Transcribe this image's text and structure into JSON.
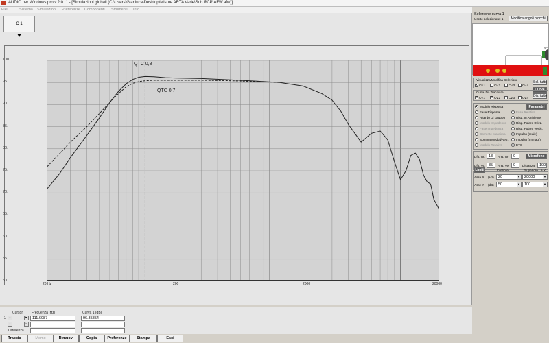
{
  "window": {
    "title": "AUDIO per Windows pro v.2.0 r1 - [Simulazioni globali (C:\\Users\\Gianluca\\Desktop\\Misure ARTA Varie\\Sub RCP\\AFW.afw)]"
  },
  "menu": [
    "File",
    "Sistema",
    "Simulazioni",
    "Preferenze",
    "Componenti",
    "Strumenti",
    "Info"
  ],
  "curve_tab": "C 1",
  "annotations": {
    "qtc08": "QTC 0,8",
    "qtc07": "QTC 0,7"
  },
  "chart_data": {
    "type": "line",
    "x_scale": "log",
    "xlim": [
      20,
      20000
    ],
    "ylim": [
      50,
      100
    ],
    "x_tick_labels": [
      "20 Hz",
      "200",
      "2000",
      "20000"
    ],
    "y_tick_labels": [
      "100.",
      "95.",
      "90.",
      "85.",
      "80.",
      "75.",
      "70.",
      "65.",
      "60.",
      "55.",
      "50."
    ],
    "grid": true,
    "series": [
      {
        "style": "solid",
        "x": [
          20,
          25,
          30,
          40,
          50,
          60,
          70,
          80,
          90,
          100,
          111.6,
          130,
          160,
          200,
          300,
          500,
          800,
          1200,
          1800,
          2500,
          3000,
          3500,
          4000,
          5000,
          6000,
          7000,
          8000,
          9000,
          10000,
          11000,
          12000,
          13000,
          14000,
          15000,
          16000,
          17000,
          18000,
          20000
        ],
        "y": [
          71,
          74.5,
          78,
          83,
          87,
          90.5,
          93,
          94.7,
          95.7,
          96.2,
          96.36,
          96.3,
          96.1,
          96,
          95.9,
          95.6,
          95.3,
          95,
          94.2,
          92.5,
          91,
          88.5,
          85.5,
          81.5,
          83.5,
          84,
          82,
          77,
          73,
          75,
          78.5,
          79,
          77.5,
          74,
          72.5,
          72,
          68.5,
          66
        ]
      },
      {
        "style": "dashed",
        "x": [
          20,
          25,
          30,
          40,
          50,
          60,
          70,
          80,
          90,
          100,
          111.6,
          130,
          160,
          200,
          300,
          500,
          800,
          1200
        ],
        "y": [
          76,
          79,
          81.5,
          85,
          88,
          90.5,
          92.5,
          94,
          94.8,
          95.2,
          95.4,
          95.5,
          95.5,
          95.5,
          95.5,
          95.4,
          95.2,
          95
        ]
      }
    ],
    "cursor_x": 111.6087
  },
  "bottom": {
    "cursors_label": "Cursori",
    "freq_label": "Frequenza [Hz]",
    "curve_label": "Curva 1 (dB)",
    "diff_label": "Differenza",
    "row1_freq": "111.6087",
    "row1_val": "96.35854",
    "row1_id": "1"
  },
  "buttons": [
    "Traccia",
    "Memo",
    "Rimuovi",
    "Copia",
    "Preferenze",
    "Stampa",
    "Esci"
  ],
  "right": {
    "sel_title": "Selezione curva 1",
    "sel_out": "Uscite selezionate: 1",
    "modify_blocks": "Modifica angoli blocchi",
    "vis_title": "Visualizza/Modifica Selezione",
    "select_all": "Sel. tutto",
    "curve_btn": "Curve",
    "trace_title": "Curve Da Tracciare",
    "deselect_all": "Dis. tutto",
    "vis_curves": [
      "Cv.1",
      "Cv.2",
      "Cv.3",
      "Cv.4"
    ],
    "trace_curves": [
      "Cv.1",
      "Cv.2",
      "Cv.3",
      "Cv.4"
    ],
    "params_btn": "Parametri",
    "radio_left": [
      "Modulo Risposta",
      "Fase Risposta",
      "Ritardo Di Gruppo",
      "Modulo Impedenza",
      "Fase Impedenza",
      "Corrente Massima",
      "Somma Moduli/Rep.",
      "Modulo Relativo"
    ],
    "radio_right": [
      "Fase Relativa",
      "Risp. In Ambiente",
      "Risp. Polare Orizz.",
      "Risp. Polare Vertic.",
      "Impulso (reale)",
      "Impulso (Immag.)",
      "ETC"
    ],
    "dist_or_label": "Dfo. Or.",
    "dist_or": "13",
    "ang_or_label": "Ang. Or.",
    "ang_or": "0",
    "mic_btn": "Microfono",
    "dist_ve_label": "Dfo. Ve.",
    "dist_ve": "35",
    "ang_ve_label": "Ang. Ve.",
    "ang_ve": "0",
    "dist_label": "Distanza",
    "dist": "100",
    "limits_btn": "Limiti",
    "lower_label": "Inferiore",
    "upper_label": "Superiore",
    "auto_y": "a.Y",
    "axis_x_label": "Asse X",
    "axis_x_unit": "(Hz)",
    "axis_x_low": "20",
    "axis_x_high": "20000",
    "axis_y_label": "Asse Y",
    "axis_y_unit": "(dB)",
    "axis_y_low": "50",
    "axis_y_high": "100",
    "schem_label": "VP"
  }
}
